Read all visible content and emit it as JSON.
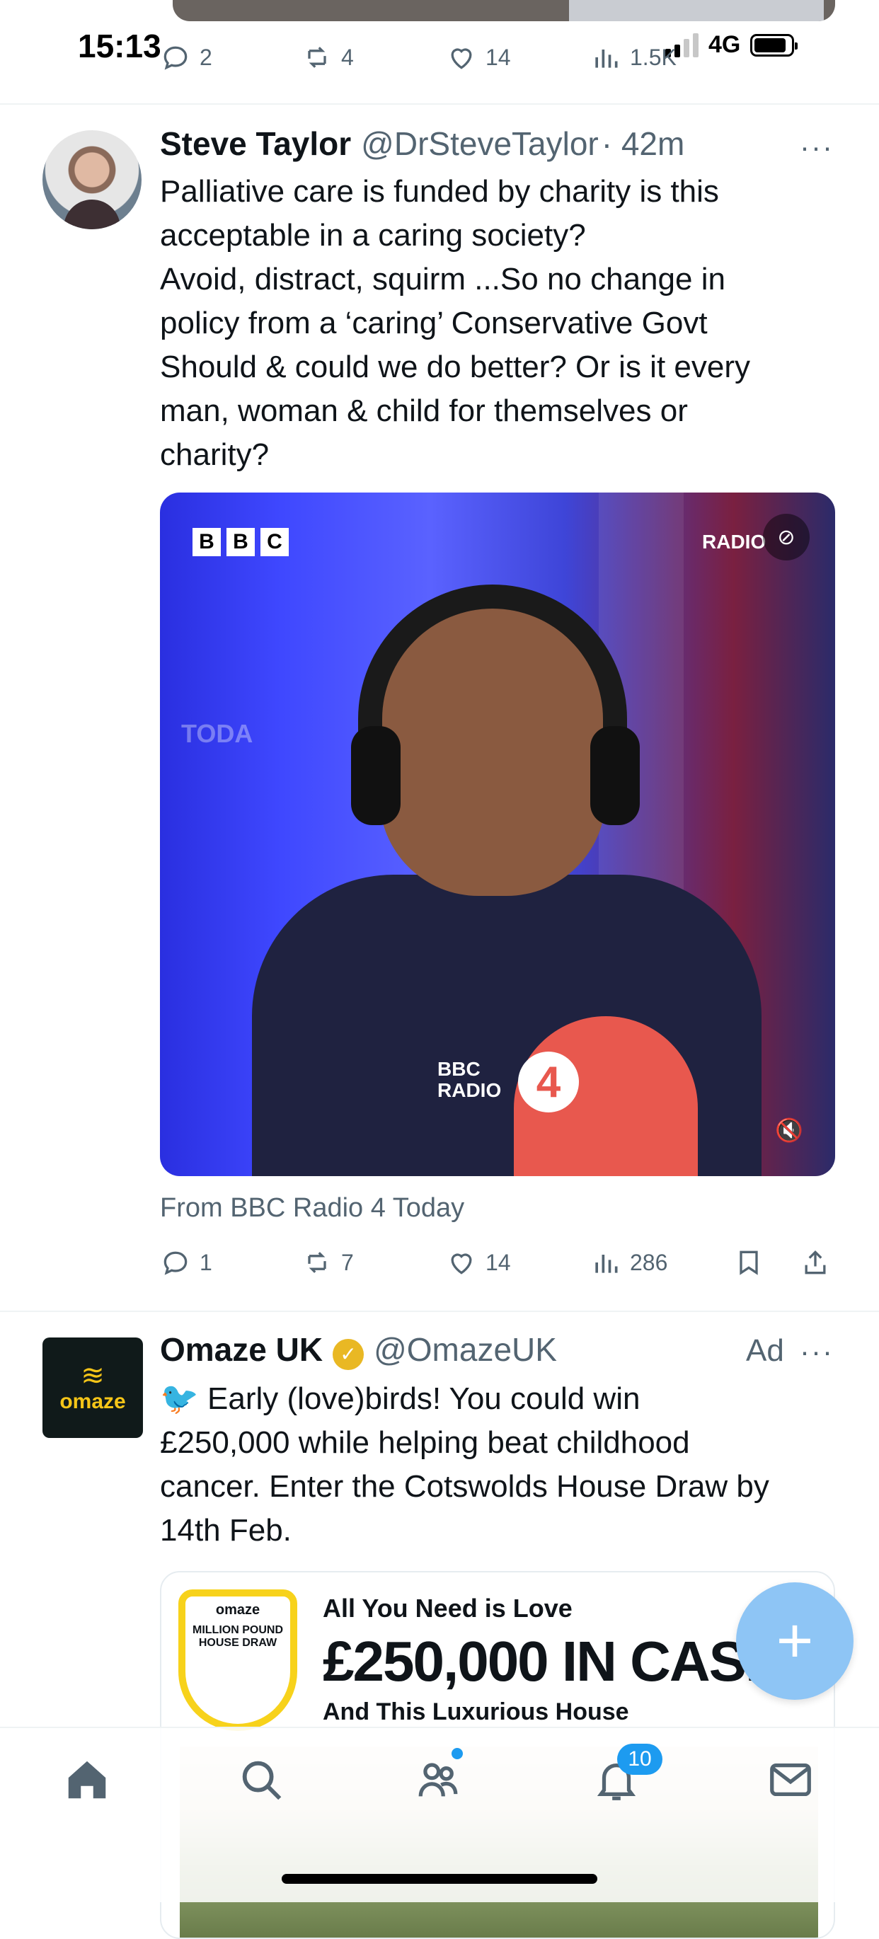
{
  "status_bar": {
    "time": "15:13",
    "network": "4G"
  },
  "prev_tweet": {
    "replies": "2",
    "retweets": "4",
    "likes": "14",
    "views": "1.5K"
  },
  "tweet": {
    "author_name": "Steve Taylor",
    "handle": "@DrSteveTaylor",
    "time": "· 42m",
    "more": "···",
    "text_lines": [
      "Palliative care is funded by charity is this",
      "acceptable in a caring society?",
      "Avoid, distract, squirm ...So no change in",
      "policy from a ‘caring’ Conservative Govt",
      "Should & could we do better? Or is it every",
      "man, woman & child for themselves or",
      "charity?"
    ],
    "video": {
      "logo_letters": [
        "B",
        "B",
        "C"
      ],
      "radio_label": "RADIO",
      "mic_label_line1": "BBC",
      "mic_label_line2": "RADIO",
      "mic_number": "4",
      "today_text": "TODA"
    },
    "source": "From BBC Radio 4 Today",
    "replies": "1",
    "retweets": "7",
    "likes": "14",
    "views": "286"
  },
  "ad_tweet": {
    "author_name": "Omaze UK",
    "handle": "@OmazeUK",
    "ad_label": "Ad",
    "more": "···",
    "logo_word": "omaze",
    "text_lines": [
      "🐦 Early (love)birds! You could win",
      "£250,000 while helping beat childhood",
      "cancer. Enter the Cotswolds House Draw by",
      "14th Feb."
    ],
    "card": {
      "badge_brand": "omaze",
      "badge_title": "MILLION POUND HOUSE DRAW",
      "headline1": "All You Need is Love",
      "headline2": "£250,000 IN CASH",
      "headline3": "And This Luxurious House"
    }
  },
  "fab_label": "+",
  "bottom_nav": {
    "items": [
      "home-icon",
      "search-icon",
      "communities-icon",
      "notifications-icon",
      "messages-icon"
    ],
    "notifications_count": "10"
  },
  "colors": {
    "accent": "#1d9bf0",
    "fab": "#8ec5f5",
    "muted": "#536471",
    "verified": "#e9b824"
  }
}
